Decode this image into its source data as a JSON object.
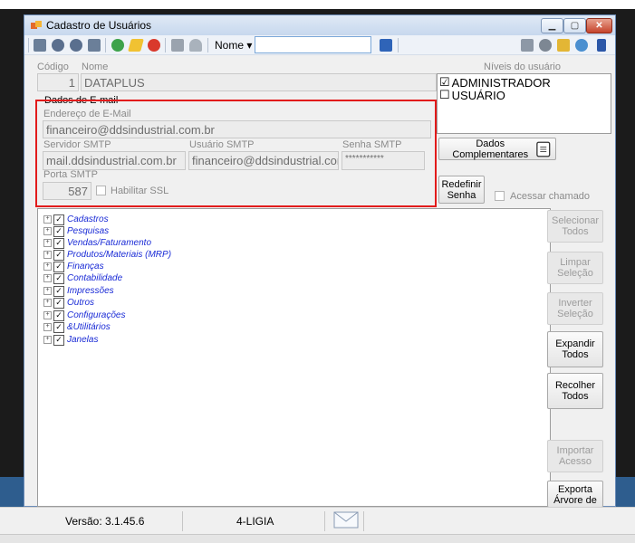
{
  "window": {
    "title": "Cadastro de Usuários"
  },
  "toolbar": {
    "nome_label": "Nome ▾",
    "search_value": ""
  },
  "form": {
    "codigo_label": "Código",
    "nome_label": "Nome",
    "codigo_value": "1",
    "nome_value": "DATAPLUS",
    "niveis_label": "Níveis do usuário",
    "niveis": [
      {
        "label": "ADMINISTRADOR",
        "checked": "☑"
      },
      {
        "label": "USUÁRIO",
        "checked": "☐"
      }
    ]
  },
  "email": {
    "group_title": "Dados de E-mail",
    "endereco_label": "Endereço de E-Mail",
    "endereco_value": "financeiro@ddsindustrial.com.br",
    "servidor_label": "Servidor SMTP",
    "servidor_value": "mail.ddsindustrial.com.br",
    "usuario_label": "Usuário SMTP",
    "usuario_value": "financeiro@ddsindustrial.com.t",
    "senha_label": "Senha SMTP",
    "senha_value": "***********",
    "porta_label": "Porta SMTP",
    "porta_value": "587",
    "ssl_label": "Habilitar SSL"
  },
  "buttons": {
    "dados_complementares": "Dados Complementares",
    "redefinir_senha_line1": "Redefinir",
    "redefinir_senha_line2": "Senha",
    "acessar_chamado": "Acessar chamado",
    "selecionar_1": "Selecionar",
    "selecionar_2": "Todos",
    "limpar_1": "Limpar",
    "limpar_2": "Seleção",
    "inverter_1": "Inverter",
    "inverter_2": "Seleção",
    "expandir_1": "Expandir",
    "expandir_2": "Todos",
    "recolher_1": "Recolher",
    "recolher_2": "Todos",
    "importar_1": "Importar",
    "importar_2": "Acesso",
    "exporta_1": "Exporta",
    "exporta_2": "Árvore de"
  },
  "tree": {
    "items": [
      "Cadastros",
      "Pesquisas",
      "Vendas/Faturamento",
      "Produtos/Materiais (MRP)",
      "Finanças",
      "Contabilidade",
      "Impressões",
      "Outros",
      "Configurações",
      "&Utilitários",
      "Janelas"
    ]
  },
  "status": {
    "versao": "Versão: 3.1.45.6",
    "usuario": "4-LIGIA"
  },
  "colors": {
    "highlight": "#e21b1b",
    "tree_text": "#1a2bd6",
    "titlebar": "#c7d8ee"
  }
}
